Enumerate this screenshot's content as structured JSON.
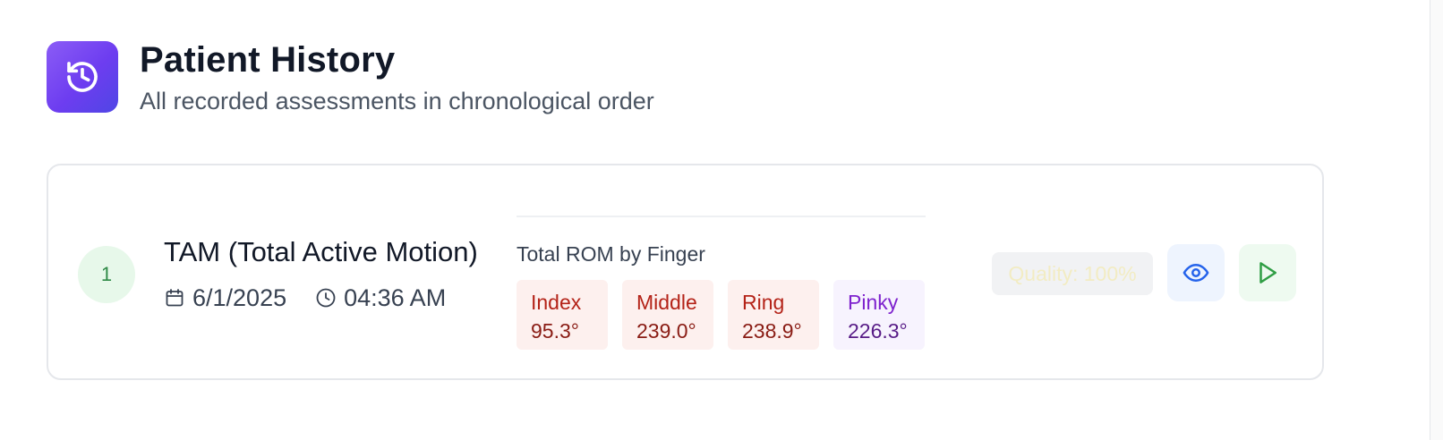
{
  "header": {
    "title": "Patient History",
    "subtitle": "All recorded assessments in chronological order",
    "icon": "history-icon"
  },
  "assessments": [
    {
      "index": "1",
      "title": "TAM (Total Active Motion)",
      "date": "6/1/2025",
      "time": "04:36 AM",
      "rom_label": "Total ROM by Finger",
      "fingers": [
        {
          "name": "Index",
          "value": "95.3°",
          "bg": "#fdf0ee",
          "name_color": "#b42318",
          "value_color": "#8a1c14"
        },
        {
          "name": "Middle",
          "value": "239.0°",
          "bg": "#fdf0ee",
          "name_color": "#b42318",
          "value_color": "#8a1c14"
        },
        {
          "name": "Ring",
          "value": "238.9°",
          "bg": "#fdf0ee",
          "name_color": "#b42318",
          "value_color": "#8a1c14"
        },
        {
          "name": "Pinky",
          "value": "226.3°",
          "bg": "#f7f3fe",
          "name_color": "#7e22ce",
          "value_color": "#581c87"
        }
      ],
      "quality": "Quality: 100%",
      "actions": {
        "view_icon": "eye-icon",
        "play_icon": "play-icon"
      }
    }
  ],
  "colors": {
    "accent_gradient_start": "#8b5cf6",
    "accent_gradient_end": "#4f46e5",
    "badge_bg": "#e7f8ea",
    "badge_text": "#2f8a47",
    "view_icon": "#2563eb",
    "play_icon": "#2f9e44"
  }
}
